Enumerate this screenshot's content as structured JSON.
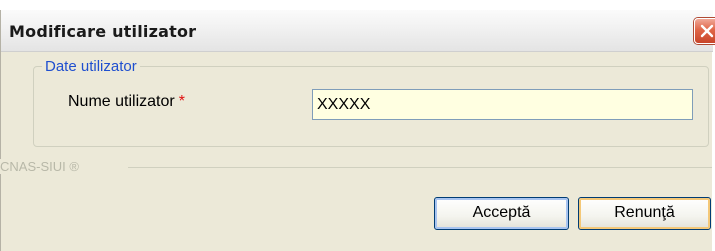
{
  "window": {
    "title": "Modificare utilizator",
    "close_icon": "close-icon"
  },
  "group": {
    "legend": "Date utilizator",
    "field_label": "Nume utilizator",
    "required_marker": "*",
    "field_value": "XXXXX"
  },
  "footer": {
    "brand": "CNAS-SIUI ®"
  },
  "buttons": {
    "accept_label": "Acceptă",
    "cancel_label": "Renunţă"
  },
  "colors": {
    "dialog_bg": "#ece9d8",
    "legend_text": "#1f4fcf",
    "required_star": "#e01010",
    "input_bg": "#ffffe1",
    "close_button": "#e06648"
  }
}
